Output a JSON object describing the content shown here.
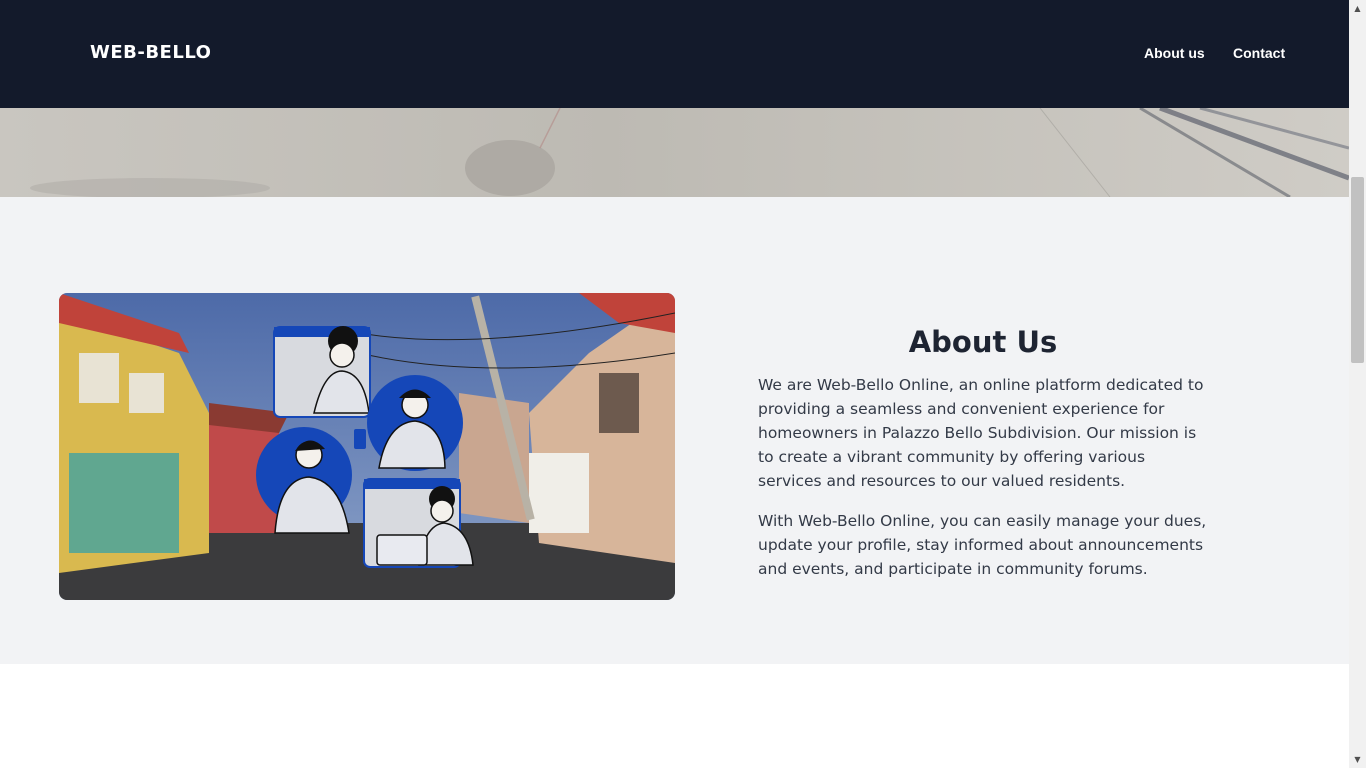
{
  "nav": {
    "brand": "WEB-BELLO",
    "links": [
      "About us",
      "Contact"
    ]
  },
  "about": {
    "title": "About Us",
    "paragraphs": [
      "We are Web-Bello Online, an online platform dedicated to providing a seamless and convenient experience for homeowners in Palazzo Bello Subdivision. Our mission is to create a vibrant community by offering various services and resources to our valued residents.",
      "With Web-Bello Online, you can easily manage your dues, update your profile, stay informed about announcements and events, and participate in community forums."
    ]
  },
  "colors": {
    "navbar_bg": "#131a2b",
    "section_bg": "#f2f3f5",
    "accent_blue": "#1547b8"
  },
  "icons": {
    "scroll_up": "triangle-up-icon",
    "scroll_down": "triangle-down-icon"
  }
}
